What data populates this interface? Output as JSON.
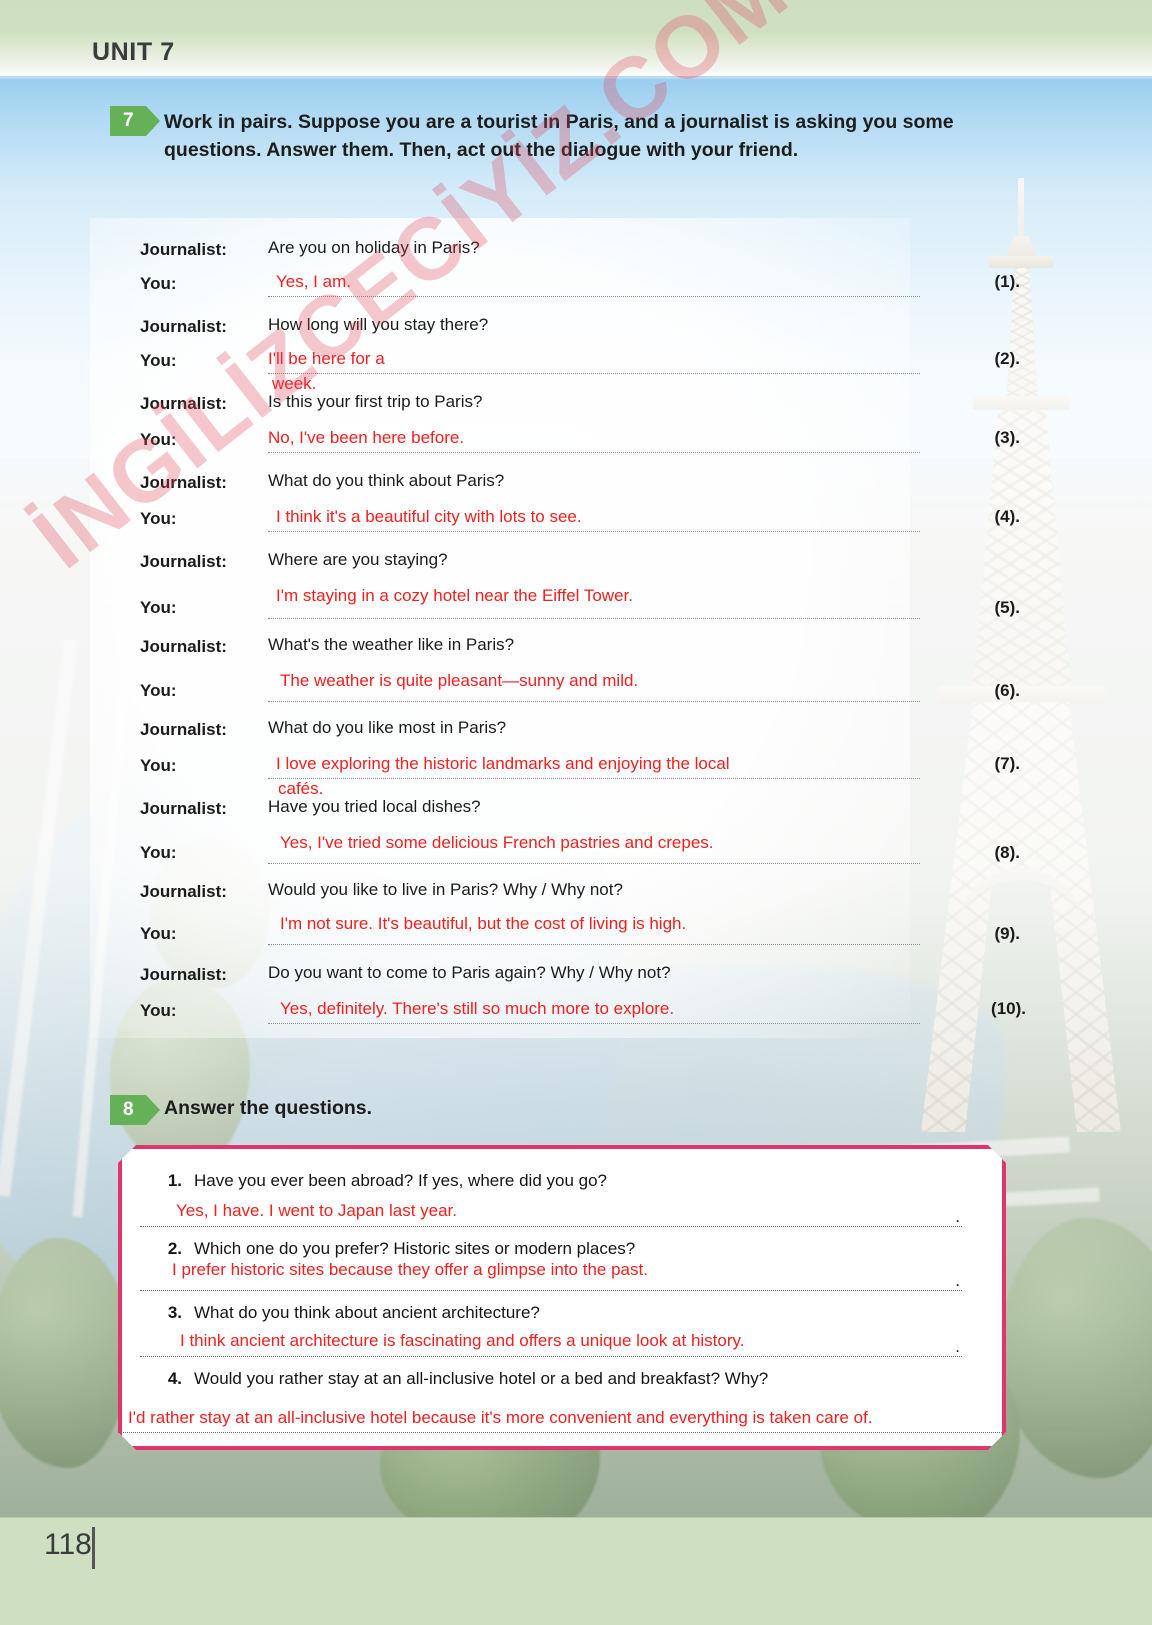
{
  "header": {
    "unit_title": "UNIT 7"
  },
  "footer": {
    "page_number": "118"
  },
  "watermark": {
    "text": "İNGİLİZCECİYİZ.COM"
  },
  "exercise7": {
    "number": "7",
    "instruction": "Work in pairs. Suppose you are a tourist in Paris, and a journalist is asking you some questions. Answer them. Then, act out the dialogue with your friend.",
    "role_journalist": "Journalist:",
    "role_you": "You:",
    "turns": [
      {
        "question": "Are you on holiday in Paris?",
        "answer": "Yes, I am.",
        "answer_line2": "",
        "number": "(1)."
      },
      {
        "question": "How long will you stay there?",
        "answer": "I'll be here for a",
        "answer_line2": "week.",
        "number": "(2)."
      },
      {
        "question": "Is this your first trip to Paris?",
        "answer": "No, I've been here before.",
        "answer_line2": "",
        "number": "(3)."
      },
      {
        "question": "What do you think about Paris?",
        "answer": "I think it's a beautiful city with lots to see.",
        "answer_line2": "",
        "number": "(4)."
      },
      {
        "question": "Where are you staying?",
        "answer": "I'm staying in a cozy hotel near the Eiffel Tower.",
        "answer_line2": "",
        "number": "(5)."
      },
      {
        "question": "What's the weather like in Paris?",
        "answer": "The weather is quite pleasant—sunny and mild.",
        "answer_line2": "",
        "number": "(6)."
      },
      {
        "question": "What do you like most in Paris?",
        "answer": "I love exploring the historic landmarks and enjoying the local",
        "answer_line2": "cafés.",
        "number": "(7)."
      },
      {
        "question": "Have you tried local dishes?",
        "answer": "Yes, I've tried some delicious French pastries and crepes.",
        "answer_line2": "",
        "number": "(8)."
      },
      {
        "question": "Would you like to live in Paris? Why / Why not?",
        "answer": "I'm not sure. It's beautiful, but the cost of living is high.",
        "answer_line2": "",
        "number": "(9)."
      },
      {
        "question": "Do you want to come to Paris again? Why / Why not?",
        "answer": "Yes, definitely. There's still so much more to explore.",
        "answer_line2": "",
        "number": "(10)."
      }
    ]
  },
  "exercise8": {
    "number": "8",
    "instruction": "Answer the questions.",
    "end_dot": ".",
    "questions": [
      {
        "number": "1.",
        "text": "Have you ever been abroad? If yes, where did you go?",
        "answer": "Yes, I have. I went to Japan last year."
      },
      {
        "number": "2.",
        "text": "Which one do you prefer? Historic sites or modern places?",
        "answer": "I prefer historic sites because they offer a glimpse into the past."
      },
      {
        "number": "3.",
        "text": "What do you think about ancient architecture?",
        "answer": "I think ancient architecture is fascinating and offers a unique look at history."
      },
      {
        "number": "4.",
        "text": "Would you rather stay at an all-inclusive hotel or a bed and breakfast? Why?",
        "answer": "I'd rather stay at an all-inclusive hotel because it's more convenient and everything is taken care of."
      }
    ]
  },
  "colors": {
    "header_green": "#cddfbe",
    "badge_green": "#64b158",
    "answer_red": "#ee2020",
    "box_pink": "#e0356b",
    "footer_green": "#cfdfc1"
  }
}
